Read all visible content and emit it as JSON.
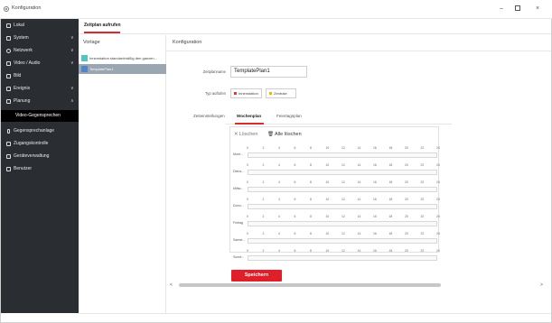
{
  "window": {
    "title": "Konfiguration",
    "min_glyph": "–",
    "close_glyph": "×"
  },
  "sidebar": {
    "items": [
      {
        "label": "Lokal",
        "icon": "monitor-icon",
        "chevron": ""
      },
      {
        "label": "System",
        "icon": "system-icon",
        "chevron": "∨"
      },
      {
        "label": "Netzwerk",
        "icon": "network-icon",
        "chevron": "∨"
      },
      {
        "label": "Video / Audio",
        "icon": "video-icon",
        "chevron": "∨"
      },
      {
        "label": "Bild",
        "icon": "image-icon",
        "chevron": ""
      },
      {
        "label": "Ereignis",
        "icon": "event-icon",
        "chevron": "∨"
      },
      {
        "label": "Planung",
        "icon": "calendar-icon",
        "chevron": "∧"
      },
      {
        "label": "Video-Gegensprechen",
        "icon": "",
        "chevron": ""
      },
      {
        "label": "Gegensprechanlage",
        "icon": "intercom-icon",
        "chevron": ""
      },
      {
        "label": "Zugangskontrolle",
        "icon": "lock-icon",
        "chevron": ""
      },
      {
        "label": "Geräteverwaltung",
        "icon": "device-icon",
        "chevron": ""
      },
      {
        "label": "Benutzer",
        "icon": "user-icon",
        "chevron": ""
      }
    ]
  },
  "tabbar": {
    "active_tab": "Zeitplan aufrufen"
  },
  "templates": {
    "header": "Vorlage",
    "items": [
      {
        "label": "Innenstation standardmäßig den ganzen...",
        "color": "#4fc7c0"
      },
      {
        "label": "TemplatePlan1",
        "color": "#4f86c7"
      }
    ]
  },
  "config": {
    "header": "Konfiguration",
    "name_label": "Zeitplanname",
    "name_value": "TemplatePlan1",
    "type_label": "Typ auftufen",
    "types": [
      {
        "label": "Innenstation",
        "color": "#e53935"
      },
      {
        "label": "Zentrale",
        "color": "#f4b400"
      }
    ],
    "sub_tabs": [
      "Zeiteinstellungen",
      "Wochenplan",
      "Feiertagsplan"
    ],
    "active_sub_tab": "Wochenplan",
    "delete_label": "Löschen",
    "delete_glyph": "✕",
    "clear_all_label": "Alle löschen",
    "clear_glyph": "🗑",
    "ticks": [
      "0",
      "2",
      "4",
      "6",
      "8",
      "10",
      "12",
      "14",
      "16",
      "18",
      "20",
      "22",
      "24"
    ],
    "days": [
      "Mont...",
      "Diens...",
      "Mittw...",
      "Donn...",
      "Freitag",
      "Samst...",
      "Sonnt..."
    ],
    "save_label": "Speichern"
  },
  "scrollbar": {
    "left_arrow": "<",
    "right_arrow": ">"
  }
}
